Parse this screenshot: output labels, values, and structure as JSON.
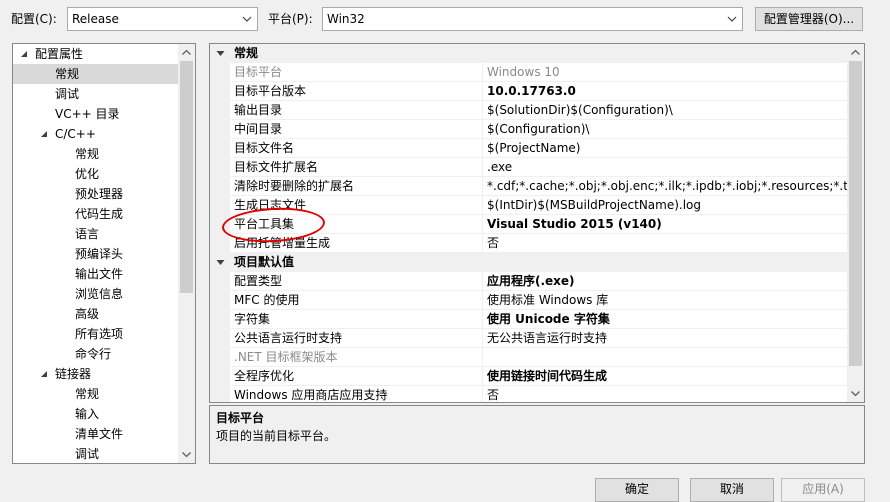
{
  "top": {
    "config_label": "配置(C):",
    "config_value": "Release",
    "platform_label": "平台(P):",
    "platform_value": "Win32",
    "config_manager_label": "配置管理器(O)..."
  },
  "tree": [
    {
      "label": "配置属性",
      "level": 0,
      "expander": "open"
    },
    {
      "label": "常规",
      "level": 1,
      "selected": true
    },
    {
      "label": "调试",
      "level": 1
    },
    {
      "label": "VC++ 目录",
      "level": 1
    },
    {
      "label": "C/C++",
      "level": 1,
      "expander": "open"
    },
    {
      "label": "常规",
      "level": 2
    },
    {
      "label": "优化",
      "level": 2
    },
    {
      "label": "预处理器",
      "level": 2
    },
    {
      "label": "代码生成",
      "level": 2
    },
    {
      "label": "语言",
      "level": 2
    },
    {
      "label": "预编译头",
      "level": 2
    },
    {
      "label": "输出文件",
      "level": 2
    },
    {
      "label": "浏览信息",
      "level": 2
    },
    {
      "label": "高级",
      "level": 2
    },
    {
      "label": "所有选项",
      "level": 2
    },
    {
      "label": "命令行",
      "level": 2
    },
    {
      "label": "链接器",
      "level": 1,
      "expander": "open"
    },
    {
      "label": "常规",
      "level": 2
    },
    {
      "label": "输入",
      "level": 2
    },
    {
      "label": "清单文件",
      "level": 2
    },
    {
      "label": "调试",
      "level": 2
    }
  ],
  "grid": [
    {
      "category": true,
      "name": "常规"
    },
    {
      "name": "目标平台",
      "value": "Windows 10",
      "gray": true
    },
    {
      "name": "目标平台版本",
      "value": "10.0.17763.0",
      "bold": true
    },
    {
      "name": "输出目录",
      "value": "$(SolutionDir)$(Configuration)\\"
    },
    {
      "name": "中间目录",
      "value": "$(Configuration)\\"
    },
    {
      "name": "目标文件名",
      "value": "$(ProjectName)"
    },
    {
      "name": "目标文件扩展名",
      "value": ".exe"
    },
    {
      "name": "清除时要删除的扩展名",
      "value": "*.cdf;*.cache;*.obj;*.obj.enc;*.ilk;*.ipdb;*.iobj;*.resources;*.tlb;*.tli;*.tlh;*.tmp;*.rsp;*.pgc;*.pgd;*.meta;*.tlog;*.manifest;*.res;*.pch;*.exp;*.idb;*.rep;*.xdc;*.pdb;*_manifest.rc;*.bsc;*.sbr;*.xml;*.metagen;*.bi"
    },
    {
      "name": "生成日志文件",
      "value": "$(IntDir)$(MSBuildProjectName).log"
    },
    {
      "name": "平台工具集",
      "value": "Visual Studio 2015 (v140)",
      "bold": true
    },
    {
      "name": "启用托管增量生成",
      "value": "否"
    },
    {
      "category": true,
      "name": "项目默认值"
    },
    {
      "name": "配置类型",
      "value": "应用程序(.exe)",
      "bold": true
    },
    {
      "name": "MFC 的使用",
      "value": "使用标准 Windows 库"
    },
    {
      "name": "字符集",
      "value": "使用 Unicode 字符集",
      "bold": true
    },
    {
      "name": "公共语言运行时支持",
      "value": "无公共语言运行时支持"
    },
    {
      "name": ".NET 目标框架版本",
      "value": "",
      "gray": true
    },
    {
      "name": "全程序优化",
      "value": "使用链接时间代码生成",
      "bold": true
    },
    {
      "name": "Windows 应用商店应用支持",
      "value": "否"
    }
  ],
  "description": {
    "title": "目标平台",
    "text": "项目的当前目标平台。"
  },
  "buttons": {
    "ok": "确定",
    "cancel": "取消",
    "apply": "应用(A)"
  },
  "colors": {
    "selected_row": "#d9d9d9",
    "annotation": "#e00000"
  }
}
